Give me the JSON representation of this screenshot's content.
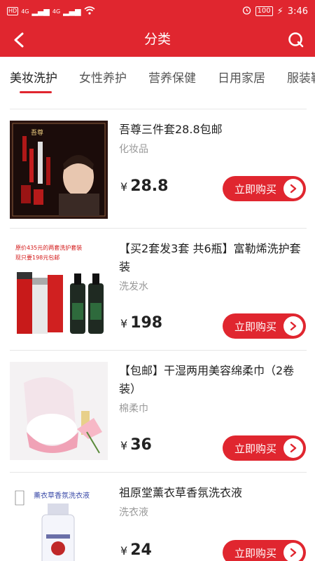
{
  "status_bar": {
    "network_left": "HD",
    "network_left2": "HD",
    "signal_1": "4G",
    "signal_2": "4G",
    "battery": "100",
    "time": "3:46"
  },
  "header": {
    "title": "分类"
  },
  "tabs": [
    {
      "label": "美妆洗护"
    },
    {
      "label": "女性养护"
    },
    {
      "label": "营养保健"
    },
    {
      "label": "日用家居"
    },
    {
      "label": "服装鞋"
    }
  ],
  "products": [
    {
      "name": "吾尊三件套28.8包邮",
      "category": "化妆品",
      "currency": "¥",
      "price": "28.8",
      "buy_label": "立即购买"
    },
    {
      "name": "【买2套发3套 共6瓶】富勒烯洗护套装",
      "category": "洗发水",
      "currency": "¥",
      "price": "198",
      "buy_label": "立即购买",
      "thumb_text_1": "原价435元的两套洗护套装",
      "thumb_text_2": "现只要198元包邮"
    },
    {
      "name": "【包邮】干湿两用美容绵柔巾（2卷装）",
      "category": "棉柔巾",
      "currency": "¥",
      "price": "36",
      "buy_label": "立即购买"
    },
    {
      "name": "祖原堂薰衣草香氛洗衣液",
      "category": "洗衣液",
      "currency": "¥",
      "price": "24",
      "buy_label": "立即购买",
      "thumb_text_1": "薰衣草香氛洗衣液"
    }
  ],
  "colors": {
    "brand_red": "#e0262f"
  }
}
